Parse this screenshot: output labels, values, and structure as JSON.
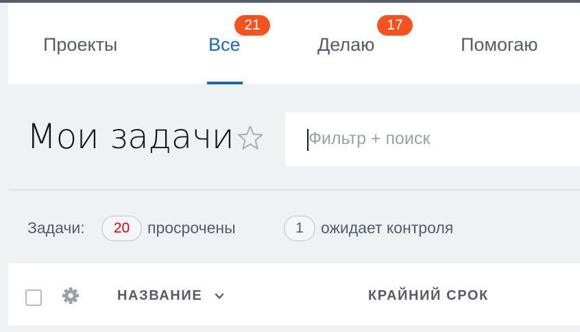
{
  "tabs": {
    "items": [
      {
        "label": "Проекты",
        "active": false
      },
      {
        "label": "Все",
        "active": true,
        "badge": "21"
      },
      {
        "label": "Делаю",
        "active": false,
        "badge": "17"
      },
      {
        "label": "Помогаю",
        "active": false
      }
    ]
  },
  "header": {
    "title": "Мои задачи",
    "favorite_icon": "star-outline-icon"
  },
  "search": {
    "placeholder": "Фильтр + поиск",
    "value": ""
  },
  "counters": {
    "prefix": "Задачи:",
    "overdue_count": "20",
    "overdue_label": "просрочены",
    "control_count": "1",
    "control_label": "ожидает контроля"
  },
  "table": {
    "columns": {
      "name": "НАЗВАНИЕ",
      "deadline": "КРАЙНИЙ СРОК"
    },
    "settings_icon": "gear-icon",
    "sort_icon": "chevron-down-icon"
  },
  "colors": {
    "accent": "#2067b0",
    "badge": "#f4521e",
    "overdue_text": "#d0021b",
    "text": "#535c69",
    "background": "#eef2f4"
  }
}
